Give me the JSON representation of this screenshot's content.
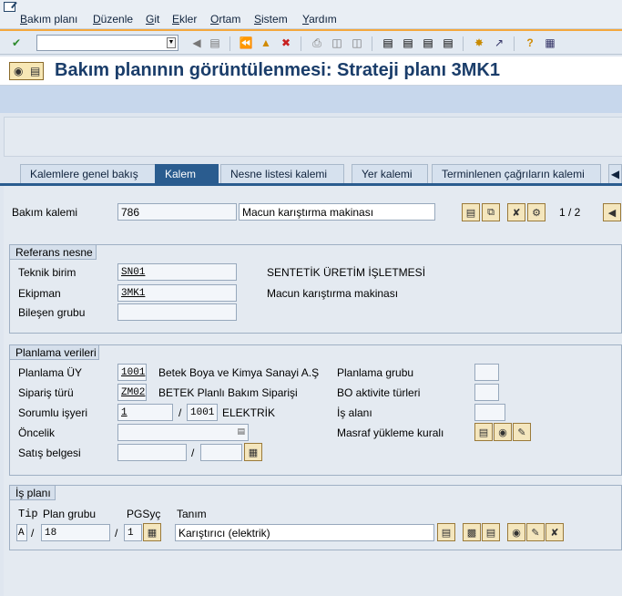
{
  "menu": [
    {
      "label": "Bakım planı",
      "u": "B"
    },
    {
      "label": "Düzenle",
      "u": "D"
    },
    {
      "label": "Git",
      "u": "G"
    },
    {
      "label": "Ekler",
      "u": "E"
    },
    {
      "label": "Ortam",
      "u": "O"
    },
    {
      "label": "Sistem",
      "u": "S"
    },
    {
      "label": "Yardım",
      "u": "Y"
    }
  ],
  "title": "Bakım planının görüntülenmesi: Strateji planı 3MK1",
  "tabs": [
    "Kalemlere genel bakış",
    "Kalem",
    "Nesne listesi kalemi",
    "Yer kalemi",
    "Terminlenen çağrıların kalemi"
  ],
  "active_tab": "Kalem",
  "item": {
    "label": "Bakım kalemi",
    "number": "786",
    "description": "Macun karıştırma makinası",
    "pager": "1 / 2"
  },
  "ref": {
    "title": "Referans nesne",
    "tech_label": "Teknik birim",
    "tech_value": "SN01",
    "tech_desc": "SENTETİK ÜRETİM İŞLETMESİ",
    "equip_label": "Ekipman",
    "equip_value": "3MK1",
    "equip_desc": "Macun karıştırma makinası",
    "assembly_label": "Bileşen grubu"
  },
  "planning": {
    "title": "Planlama verileri",
    "plant_label": "Planlama ÜY",
    "plant_value": "1001",
    "plant_desc": "Betek Boya ve Kimya Sanayi A.Ş",
    "order_type_label": "Sipariş türü",
    "order_type_value": "ZM02",
    "order_type_desc": "BETEK Planlı Bakım Siparişi",
    "resp_label": "Sorumlu işyeri",
    "resp_value": "1",
    "resp_plant": "1001",
    "resp_desc": "ELEKTRİK",
    "priority_label": "Öncelik",
    "sales_label": "Satış belgesi",
    "slash": "/",
    "plan_group_label": "Planlama grubu",
    "bo_label": "BO aktivite türleri",
    "area_label": "İş alanı",
    "cost_label": "Masraf yükleme kuralı"
  },
  "tasklist": {
    "title": "İş planı",
    "col_type": "Tip",
    "col_group": "Plan grubu",
    "col_counter": "PGSyç",
    "col_desc": "Tanım",
    "type_value": "A",
    "group_value": "18",
    "counter_value": "1",
    "desc_value": "Karıştırıcı (elektrik)",
    "slash": "/"
  }
}
